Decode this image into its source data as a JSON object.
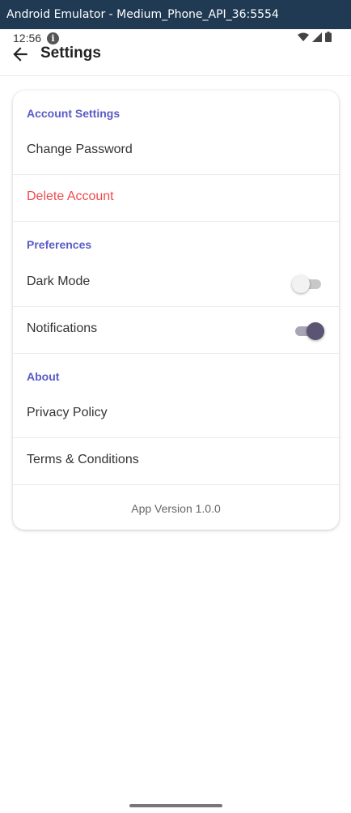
{
  "emulator": {
    "title": "Android Emulator - Medium_Phone_API_36:5554"
  },
  "status_bar": {
    "time": "12:56",
    "info_icon": "i"
  },
  "app_bar": {
    "title": "Settings"
  },
  "sections": {
    "account": {
      "header": "Account Settings",
      "change_password": "Change Password",
      "delete_account": "Delete Account"
    },
    "preferences": {
      "header": "Preferences",
      "dark_mode": {
        "label": "Dark Mode",
        "enabled": false
      },
      "notifications": {
        "label": "Notifications",
        "enabled": true
      }
    },
    "about": {
      "header": "About",
      "privacy_policy": "Privacy Policy",
      "terms": "Terms & Conditions"
    }
  },
  "app_version": "App Version 1.0.0",
  "colors": {
    "accent": "#5a5bc7",
    "danger": "#ef4a4f",
    "emulator_bar": "#1f3a52",
    "toggle_on": "#5b5472"
  }
}
